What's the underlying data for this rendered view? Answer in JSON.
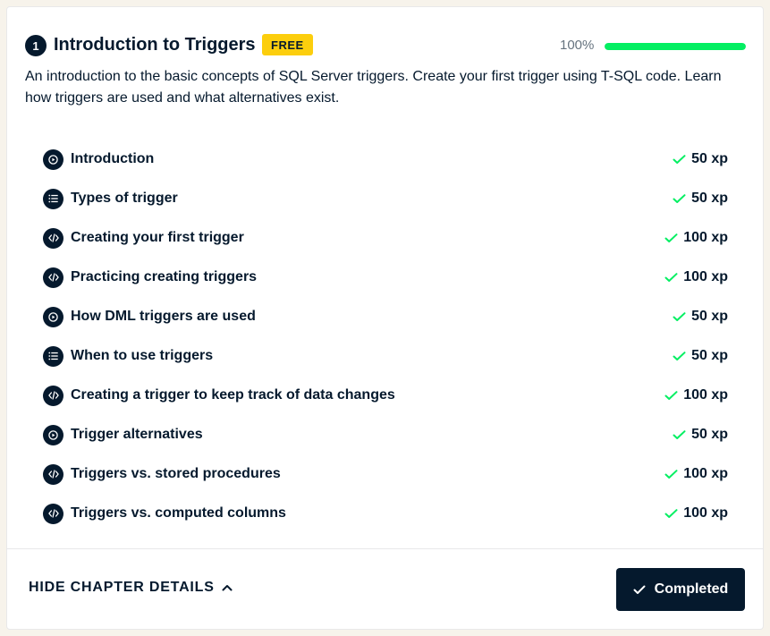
{
  "chapter": {
    "number": "1",
    "title": "Introduction to Triggers",
    "badge": "FREE",
    "progress_label": "100%",
    "progress_fraction": 1.0,
    "description": "An introduction to the basic concepts of SQL Server triggers. Create your first trigger using T-SQL code. Learn how triggers are used and what alternatives exist."
  },
  "lessons": [
    {
      "title": "Introduction",
      "type": "video-icon",
      "xp": "50 xp"
    },
    {
      "title": "Types of trigger",
      "type": "list-icon",
      "xp": "50 xp"
    },
    {
      "title": "Creating your first trigger",
      "type": "code-icon",
      "xp": "100 xp"
    },
    {
      "title": "Practicing creating triggers",
      "type": "code-icon",
      "xp": "100 xp"
    },
    {
      "title": "How DML triggers are used",
      "type": "video-icon",
      "xp": "50 xp"
    },
    {
      "title": "When to use triggers",
      "type": "list-icon",
      "xp": "50 xp"
    },
    {
      "title": "Creating a trigger to keep track of data changes",
      "type": "code-icon",
      "xp": "100 xp"
    },
    {
      "title": "Trigger alternatives",
      "type": "video-icon",
      "xp": "50 xp"
    },
    {
      "title": "Triggers vs. stored procedures",
      "type": "code-icon",
      "xp": "100 xp"
    },
    {
      "title": "Triggers vs. computed columns",
      "type": "code-icon",
      "xp": "100 xp"
    }
  ],
  "footer": {
    "hide_label": "HIDE CHAPTER DETAILS",
    "completed_label": "Completed"
  },
  "colors": {
    "navy": "#05192d",
    "green": "#03ef62",
    "check_green": "#03ef62",
    "badge_yellow": "#fcce0d"
  }
}
